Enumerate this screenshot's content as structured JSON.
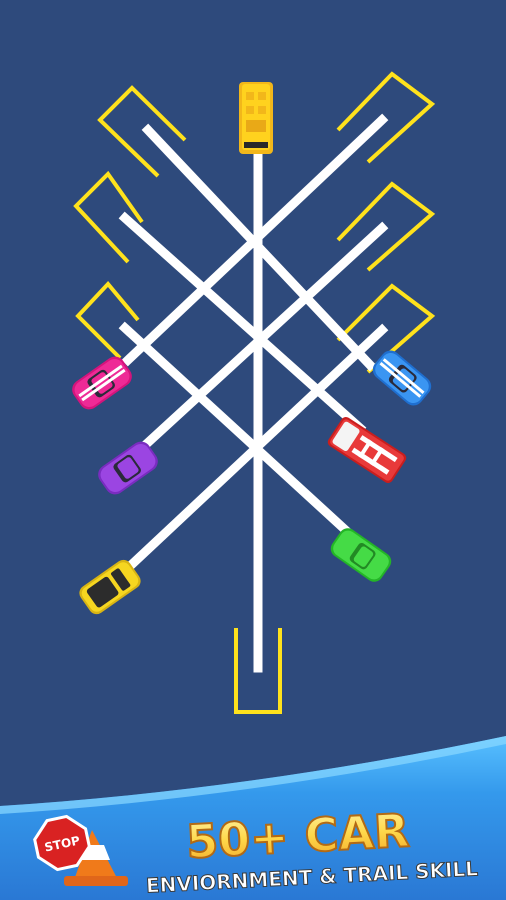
{
  "game": {
    "background_color": "#2e4a7c",
    "trail_color": "#ffffff",
    "slot_color": "#ffe21c",
    "cars": [
      {
        "name": "bus",
        "color": "#ffd21e"
      },
      {
        "name": "pink-car",
        "color": "#e8198a"
      },
      {
        "name": "purple-car",
        "color": "#8e3ad6"
      },
      {
        "name": "yellow-car",
        "color": "#f4d21c"
      },
      {
        "name": "blue-car",
        "color": "#2f8ff0"
      },
      {
        "name": "fire-truck",
        "color": "#e03030"
      },
      {
        "name": "green-car",
        "color": "#38d43a"
      }
    ]
  },
  "promo": {
    "headline": "50+ CAR",
    "subline": "ENVIORNMENT & TRAIL SKILL",
    "stop_sign_text": "STOP",
    "headline_color": "#ffd84a",
    "banner_color": "#2f8fe8"
  }
}
